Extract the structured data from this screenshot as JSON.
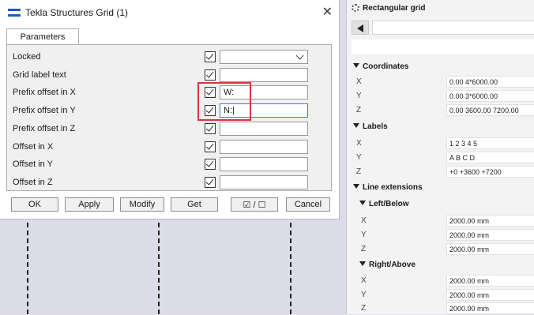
{
  "dialog": {
    "title": "Tekla Structures  Grid (1)",
    "close_glyph": "✕",
    "tab_label": "Parameters",
    "rows": [
      {
        "label": "Locked",
        "value": "",
        "dropdown": true
      },
      {
        "label": "Grid label text",
        "value": ""
      },
      {
        "label": "Prefix offset in X",
        "value": "W:"
      },
      {
        "label": "Prefix offset in Y",
        "value": "N:|"
      },
      {
        "label": "Prefix offset in Z",
        "value": ""
      },
      {
        "label": "Offset in X",
        "value": ""
      },
      {
        "label": "Offset in Y",
        "value": ""
      },
      {
        "label": "Offset in Z",
        "value": ""
      }
    ],
    "buttons": {
      "ok": "OK",
      "apply": "Apply",
      "modify": "Modify",
      "get": "Get",
      "toggle": "☑ / ☐",
      "cancel": "Cancel"
    },
    "highlight_color": "#e0333a"
  },
  "properties": {
    "header": "Rectangular grid",
    "coordinates": {
      "title": "Coordinates",
      "x": "0.00 4*6000.00",
      "y": "0.00 3*6000.00",
      "z": "0.00 3600.00 7200.00"
    },
    "labels": {
      "title": "Labels",
      "x": "1 2 3 4 5",
      "y": "A B C D",
      "z": "+0 +3600 +7200"
    },
    "line_extensions": {
      "title": "Line extensions",
      "left_below": {
        "title": "Left/Below",
        "x": "2000.00 mm",
        "y": "2000.00 mm",
        "z": "2000.00 mm"
      },
      "right_above": {
        "title": "Right/Above",
        "x": "2000.00 mm",
        "y": "2000.00 mm",
        "z": "2000.00 mm"
      }
    },
    "axis": {
      "x": "X",
      "y": "Y",
      "z": "Z"
    }
  },
  "colors": {
    "accent": "#1f5fa8",
    "canvas": "#dcdce8"
  }
}
